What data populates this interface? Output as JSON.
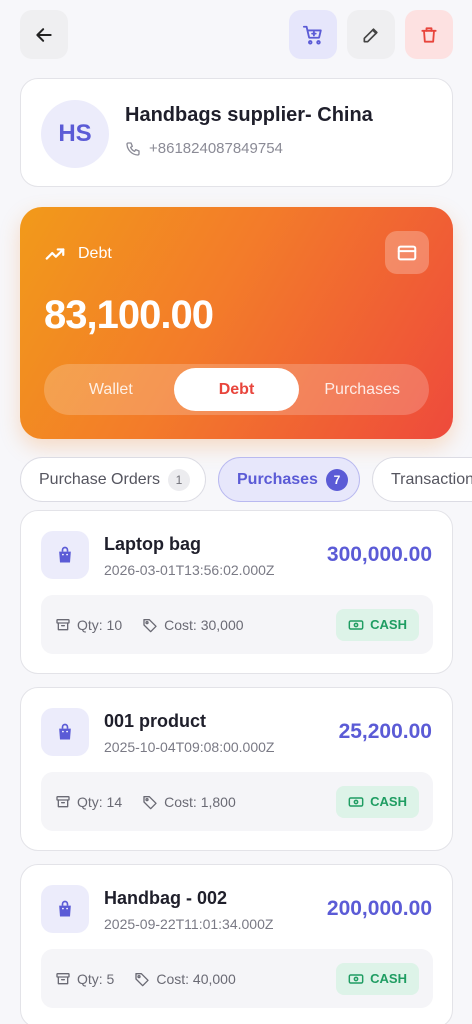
{
  "header": {
    "back_icon": "arrow-left-icon",
    "cart_icon": "cart-plus-icon",
    "edit_icon": "pencil-icon",
    "delete_icon": "trash-icon"
  },
  "supplier": {
    "initials": "HS",
    "name": "Handbags supplier- China",
    "phone": "+861824087849754"
  },
  "balance_card": {
    "label": "Debt",
    "amount": "83,100.00",
    "segments": [
      "Wallet",
      "Debt",
      "Purchases"
    ],
    "active_segment": "Debt",
    "colors": {
      "gradient_start": "#f29a1a",
      "gradient_end": "#ee4a3c"
    }
  },
  "tabs": [
    {
      "label": "Purchase Orders",
      "count": "1"
    },
    {
      "label": "Purchases",
      "count": "7"
    },
    {
      "label": "Transactions",
      "count": ""
    }
  ],
  "purchases": [
    {
      "name": "Laptop bag",
      "date": "2026-03-01T13:56:02.000Z",
      "amount": "300,000.00",
      "qty": "Qty: 10",
      "cost": "Cost: 30,000",
      "payment": "CASH"
    },
    {
      "name": "001 product",
      "date": "2025-10-04T09:08:00.000Z",
      "amount": "25,200.00",
      "qty": "Qty: 14",
      "cost": "Cost: 1,800",
      "payment": "CASH"
    },
    {
      "name": "Handbag - 002",
      "date": "2025-09-22T11:01:34.000Z",
      "amount": "200,000.00",
      "qty": "Qty: 5",
      "cost": "Cost: 40,000",
      "payment": "CASH"
    }
  ],
  "colors": {
    "accent": "#5b5bd6",
    "cash_green": "#1f9d62",
    "danger": "#e8453c"
  }
}
